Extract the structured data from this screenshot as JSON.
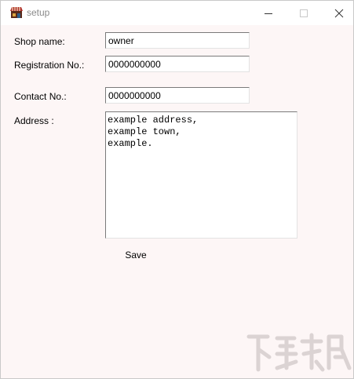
{
  "window": {
    "title": "setup"
  },
  "form": {
    "shop_name_label": "Shop name:",
    "shop_name_value": "owner",
    "registration_label": "Registration No.:",
    "registration_value": "0000000000",
    "contact_label": "Contact No.:",
    "contact_value": "0000000000",
    "address_label": "Address :",
    "address_value": "example address,\nexample town,\nexample.",
    "save_label": "Save"
  },
  "icons": {
    "app": "shop-icon",
    "minimize": "minimize-icon",
    "maximize": "maximize-icon",
    "close": "close-icon"
  },
  "colors": {
    "window_bg": "#fdf6f6",
    "titlebar_bg": "#ffffff",
    "title_text": "#8a8a8a"
  }
}
